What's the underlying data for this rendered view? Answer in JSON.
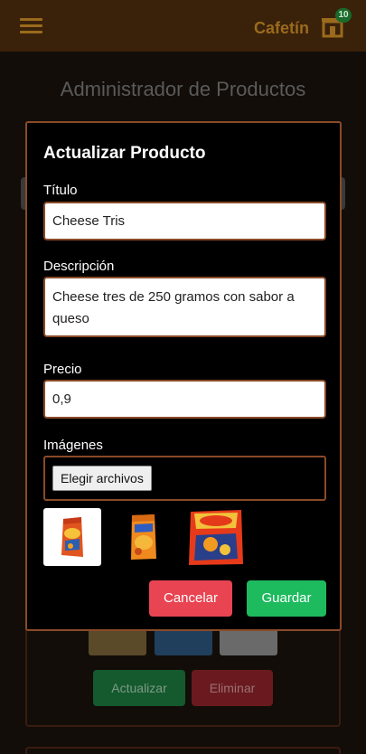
{
  "nav": {
    "brand": "Cafetín",
    "cart_count": "10",
    "menu_icon": "hamburger-icon",
    "cart_icon": "shop-icon"
  },
  "page": {
    "title": "Administrador de Productos",
    "actions": {
      "update_label": "Actualizar",
      "delete_label": "Eliminar"
    }
  },
  "modal": {
    "title": "Actualizar Producto",
    "fields": {
      "title_label": "Título",
      "title_value": "Cheese Tris",
      "description_label": "Descripción",
      "description_value": "Cheese tres de 250 gramos con sabor a queso",
      "price_label": "Precio",
      "price_value": "0,9",
      "images_label": "Imágenes",
      "file_button_label": "Elegir archivos"
    },
    "cancel_label": "Cancelar",
    "save_label": "Guardar"
  },
  "colors": {
    "nav_bg": "#3a210a",
    "accent": "#9a6b1c",
    "modal_border": "#8a4a28",
    "cancel": "#e84452",
    "save": "#1dba5e"
  }
}
